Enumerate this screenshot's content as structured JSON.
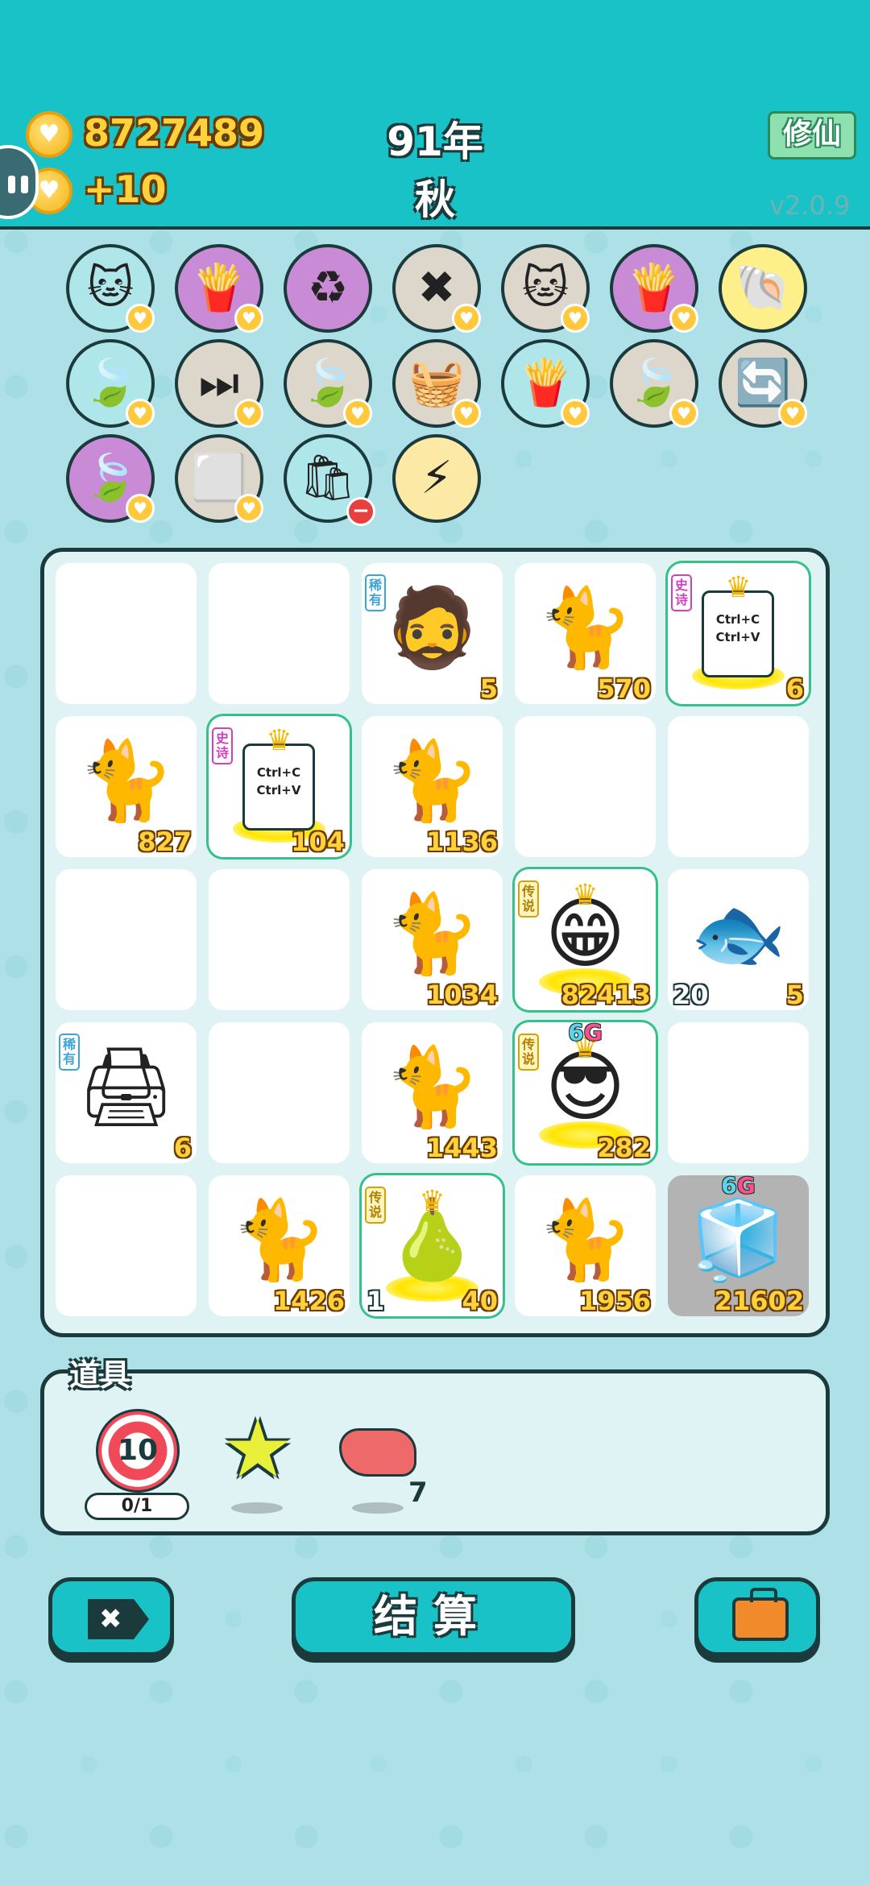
{
  "header": {
    "coins": "8727489",
    "income": "+10",
    "year": "91年",
    "season": "秋",
    "mode_button": "修仙",
    "version": "v2.0.9"
  },
  "items_bar": [
    {
      "icon": "cat-icon",
      "emoji": "🐱",
      "bg": "teal",
      "badge": "heart"
    },
    {
      "icon": "fries-icon",
      "emoji": "🍟",
      "bg": "purple",
      "badge": "heart"
    },
    {
      "icon": "recycle-icon",
      "emoji": "♻",
      "bg": "purple",
      "badge": ""
    },
    {
      "icon": "remove-tag-icon",
      "emoji": "✖",
      "bg": "gray",
      "badge": "heart"
    },
    {
      "icon": "twin-cats-icon",
      "emoji": "🐱",
      "bg": "gray",
      "badge": "heart"
    },
    {
      "icon": "fries-icon",
      "emoji": "🍟",
      "bg": "purple",
      "badge": "heart"
    },
    {
      "icon": "shell-icon",
      "emoji": "🐚",
      "bg": "yellow",
      "badge": ""
    },
    {
      "icon": "leaf-icon",
      "emoji": "🍃",
      "bg": "teal",
      "badge": "heart"
    },
    {
      "icon": "skip-icon",
      "emoji": "⏭",
      "bg": "gray",
      "badge": "heart"
    },
    {
      "icon": "leaf-icon",
      "emoji": "🍃",
      "bg": "gray",
      "badge": "heart"
    },
    {
      "icon": "fruit-basket-icon",
      "emoji": "🧺",
      "bg": "gray",
      "badge": "heart"
    },
    {
      "icon": "fries-icon",
      "emoji": "🍟",
      "bg": "teal",
      "badge": "heart"
    },
    {
      "icon": "leaf-icon",
      "emoji": "🍃",
      "bg": "gray",
      "badge": "heart"
    },
    {
      "icon": "refresh-icon",
      "emoji": "🔄",
      "bg": "gray",
      "badge": "heart"
    },
    {
      "icon": "leaf-icon",
      "emoji": "🍃",
      "bg": "purple",
      "badge": "heart"
    },
    {
      "icon": "sugar-cubes-icon",
      "emoji": "⬜",
      "bg": "gray",
      "badge": "heart"
    },
    {
      "icon": "trash-bag-icon",
      "emoji": "🛍",
      "bg": "teal",
      "badge": "minus"
    },
    {
      "icon": "lightning-icon",
      "emoji": "⚡",
      "bg": "cream",
      "badge": ""
    }
  ],
  "board": [
    {
      "icon": "",
      "value": "",
      "left_value": "",
      "tag": ""
    },
    {
      "icon": "",
      "value": "",
      "left_value": "",
      "tag": ""
    },
    {
      "icon": "bucket-hat-man-icon",
      "emoji": "🧔",
      "value": "5",
      "left_value": "",
      "tag": "稀有",
      "tag_type": "rare"
    },
    {
      "icon": "cat-icon",
      "emoji": "🐈",
      "value": "570",
      "left_value": "",
      "tag": ""
    },
    {
      "icon": "ctrl-cv-icon",
      "value": "6",
      "left_value": "",
      "tag": "史诗",
      "tag_type": "epic",
      "ctrl": "Ctrl+C Ctrl+V"
    },
    {
      "icon": "cat-icon",
      "emoji": "🐈",
      "value": "827",
      "left_value": "",
      "tag": ""
    },
    {
      "icon": "ctrl-cv-icon",
      "value": "104",
      "left_value": "",
      "tag": "史诗",
      "tag_type": "epic",
      "ctrl": "Ctrl+C Ctrl+V"
    },
    {
      "icon": "cat-icon",
      "emoji": "🐈",
      "value": "1136",
      "left_value": "",
      "tag": ""
    },
    {
      "icon": "",
      "value": "",
      "left_value": "",
      "tag": ""
    },
    {
      "icon": "",
      "value": "",
      "left_value": "",
      "tag": ""
    },
    {
      "icon": "",
      "value": "",
      "left_value": "",
      "tag": ""
    },
    {
      "icon": "",
      "value": "",
      "left_value": "",
      "tag": ""
    },
    {
      "icon": "cat-icon",
      "emoji": "🐈",
      "value": "1034",
      "left_value": "",
      "tag": ""
    },
    {
      "icon": "grinning-old-man-icon",
      "emoji": "😁",
      "value": "82413",
      "left_value": "",
      "tag": "传说",
      "tag_type": "legend",
      "crown": true
    },
    {
      "icon": "fish-icon",
      "emoji": "🐟",
      "value": "5",
      "left_value": "20",
      "tag": ""
    },
    {
      "icon": "printer-icon",
      "emoji": "🖨",
      "value": "6",
      "left_value": "",
      "tag": "稀有",
      "tag_type": "rare"
    },
    {
      "icon": "",
      "value": "",
      "left_value": "",
      "tag": ""
    },
    {
      "icon": "cat-icon",
      "emoji": "🐈",
      "value": "1443",
      "left_value": "",
      "tag": ""
    },
    {
      "icon": "sunglasses-man-icon",
      "emoji": "😎",
      "value": "282",
      "left_value": "",
      "tag": "传说",
      "tag_type": "legend",
      "crown": true,
      "g6": "6G"
    },
    {
      "icon": "",
      "value": "",
      "left_value": "",
      "tag": ""
    },
    {
      "icon": "",
      "value": "",
      "left_value": "",
      "tag": ""
    },
    {
      "icon": "cat-icon",
      "emoji": "🐈",
      "value": "1426",
      "left_value": "",
      "tag": ""
    },
    {
      "icon": "golden-pear-icon",
      "emoji": "🍐",
      "value": "40",
      "left_value": "1",
      "tag": "传说",
      "tag_type": "legend",
      "crown": true
    },
    {
      "icon": "cat-icon",
      "emoji": "🐈",
      "value": "1956",
      "left_value": "",
      "tag": ""
    },
    {
      "icon": "fridge-icon",
      "emoji": "🧊",
      "value": "21602",
      "left_value": "",
      "tag": "",
      "g6": "6G",
      "dark": true
    }
  ],
  "tools": {
    "title": "道具",
    "target_value": "10",
    "target_count": "0/1",
    "liver_count": "7"
  },
  "buttons": {
    "settle": "结算"
  }
}
